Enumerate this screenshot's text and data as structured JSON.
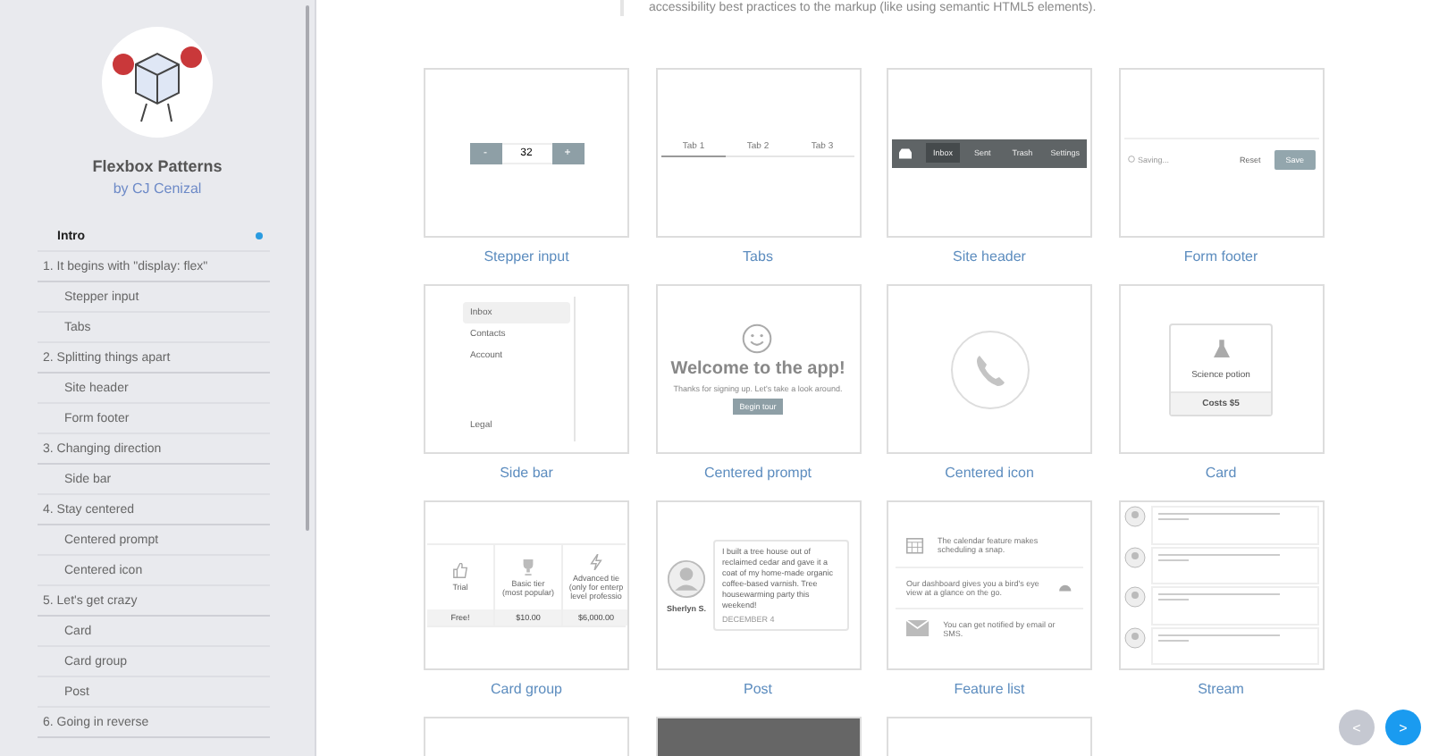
{
  "sidebar": {
    "title": "Flexbox Patterns",
    "author": "by CJ Cenizal",
    "nav": [
      {
        "label": "Intro",
        "kind": "intro",
        "selected": true
      },
      {
        "label": "1. It begins with \"display: flex\"",
        "kind": "section",
        "selected": false
      },
      {
        "label": "Stepper input",
        "kind": "item",
        "selected": false
      },
      {
        "label": "Tabs",
        "kind": "item",
        "selected": false
      },
      {
        "label": "2. Splitting things apart",
        "kind": "section",
        "selected": false
      },
      {
        "label": "Site header",
        "kind": "item",
        "selected": false
      },
      {
        "label": "Form footer",
        "kind": "item",
        "selected": false
      },
      {
        "label": "3. Changing direction",
        "kind": "section",
        "selected": false
      },
      {
        "label": "Side bar",
        "kind": "item",
        "selected": false
      },
      {
        "label": "4. Stay centered",
        "kind": "section",
        "selected": false
      },
      {
        "label": "Centered prompt",
        "kind": "item",
        "selected": false
      },
      {
        "label": "Centered icon",
        "kind": "item",
        "selected": false
      },
      {
        "label": "5. Let's get crazy",
        "kind": "section",
        "selected": false
      },
      {
        "label": "Card",
        "kind": "item",
        "selected": false
      },
      {
        "label": "Card group",
        "kind": "item",
        "selected": false
      },
      {
        "label": "Post",
        "kind": "item",
        "selected": false
      },
      {
        "label": "6. Going in reverse",
        "kind": "section",
        "selected": false
      }
    ]
  },
  "intro_text": "accessibility best practices to the markup (like using semantic HTML5 elements).",
  "patterns": [
    {
      "kind": "stepper",
      "caption": "Stepper input",
      "minus": "-",
      "value": "32",
      "plus": "+"
    },
    {
      "kind": "tabs",
      "caption": "Tabs",
      "tabs": [
        {
          "label": "Tab 1",
          "selected": true
        },
        {
          "label": "Tab 2",
          "selected": false
        },
        {
          "label": "Tab 3",
          "selected": false
        }
      ]
    },
    {
      "kind": "site_header",
      "caption": "Site header",
      "items": [
        {
          "label": "Inbox",
          "selected": true
        },
        {
          "label": "Sent",
          "selected": false
        },
        {
          "label": "Trash",
          "selected": false
        }
      ],
      "settings": "Settings"
    },
    {
      "kind": "form_footer",
      "caption": "Form footer",
      "status": "Saving...",
      "reset": "Reset",
      "save": "Save"
    },
    {
      "kind": "side_bar",
      "caption": "Side bar",
      "items": [
        {
          "label": "Inbox",
          "selected": true
        },
        {
          "label": "Contacts",
          "selected": false
        },
        {
          "label": "Account",
          "selected": false
        }
      ],
      "footer": "Legal"
    },
    {
      "kind": "prompt",
      "caption": "Centered prompt",
      "title": "Welcome to the app!",
      "text": "Thanks for signing up. Let's take a look around.",
      "button": "Begin tour"
    },
    {
      "kind": "icon",
      "caption": "Centered icon"
    },
    {
      "kind": "card",
      "caption": "Card",
      "name": "Science potion",
      "price": "Costs $5"
    },
    {
      "kind": "card_group",
      "caption": "Card group",
      "cards": [
        {
          "kind": "thumb",
          "name": "Trial",
          "price": "Free!"
        },
        {
          "kind": "trophy",
          "name": "Basic tier\n(most popular)",
          "price": "$10.00"
        },
        {
          "kind": "bolt",
          "name": "Advanced tie\n(only for enterp\nlevel professio",
          "price": "$6,000.00"
        }
      ]
    },
    {
      "kind": "post",
      "caption": "Post",
      "author": "Sherlyn S.",
      "text": "I built a tree house out of reclaimed cedar and gave it a coat of my home-made organic coffee-based varnish. Tree housewarming party this weekend!",
      "date": "DECEMBER 4"
    },
    {
      "kind": "feature_list",
      "caption": "Feature list",
      "features": [
        {
          "kind": "calendar",
          "text": "The calendar feature makes scheduling a snap."
        },
        {
          "kind": "gauge",
          "text": "Our dashboard gives you a bird's eye view at a glance on the go."
        },
        {
          "kind": "mail",
          "text": "You can get notified by email or SMS."
        }
      ]
    },
    {
      "kind": "stream",
      "caption": "Stream"
    }
  ],
  "pager": {
    "prev": "<",
    "next": ">"
  }
}
